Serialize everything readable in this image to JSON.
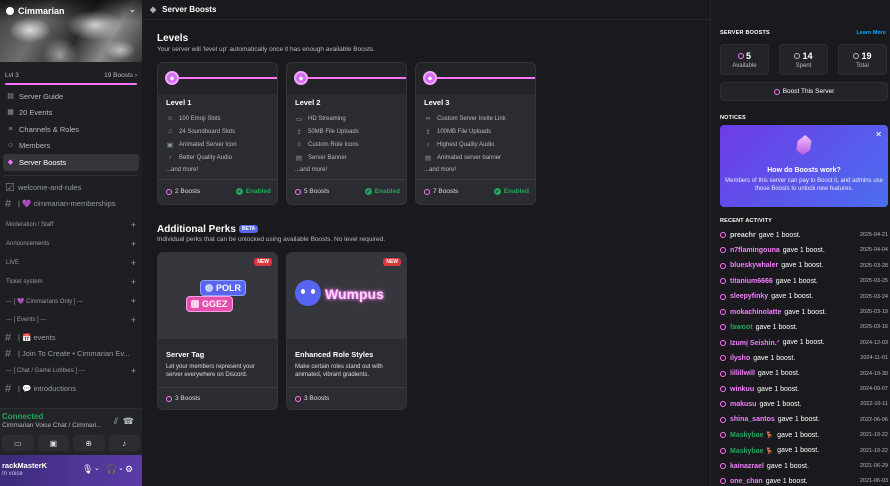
{
  "sidebar": {
    "server_name": "Cimmarian",
    "level_label": "Lvl 3",
    "boosts_label": "19 Boosts",
    "boost_progress": 1.0,
    "nav": [
      {
        "label": "Server Guide",
        "icon": "guide-icon"
      },
      {
        "label": "20 Events",
        "icon": "calendar-icon"
      },
      {
        "label": "Channels & Roles",
        "icon": "channels-icon"
      },
      {
        "label": "Members",
        "icon": "members-icon"
      },
      {
        "label": "Server Boosts",
        "icon": "boost-icon",
        "active": true
      }
    ],
    "channels_top": [
      {
        "label": "welcome-and-rules",
        "icon": "rules-icon"
      },
      {
        "label": "| 💜 cimmarian-memberships",
        "icon": "hash-icon"
      }
    ],
    "categories": [
      "Moderation / Staff",
      "Announcements",
      "LIVE",
      "Ticket system",
      "--- [ 💜 Cimmarians Only ] ---",
      "--- [ Events ] ---",
      "--- [ Chat / Game Lobbies ] ---"
    ],
    "channels_events": [
      {
        "label": "| 📅 events"
      },
      {
        "label": "| Join To Create • Cimmarian Ev..."
      }
    ],
    "channels_chat": [
      {
        "label": "| 💬 introductions"
      }
    ],
    "voice": {
      "status": "Connected",
      "channel": "Cimmarian Voice Chat / Cimmari..."
    },
    "user": {
      "name": "rackMasterK",
      "status": "In voice"
    }
  },
  "header": {
    "title": "Server Boosts"
  },
  "levels": {
    "title": "Levels",
    "subtitle": "Your server will 'level up' automatically once it has enough available Boosts.",
    "cards": [
      {
        "name": "Level 1",
        "perks": [
          "100 Emoji Slots",
          "24 Soundboard Slots",
          "Animated Server Icon",
          "Better Quality Audio",
          "...and more!"
        ],
        "boosts": "2 Boosts",
        "status": "Enabled"
      },
      {
        "name": "Level 2",
        "perks": [
          "HD Streaming",
          "50MB File Uploads",
          "Custom Role Icons",
          "Server Banner",
          "...and more!"
        ],
        "boosts": "5 Boosts",
        "status": "Enabled"
      },
      {
        "name": "Level 3",
        "perks": [
          "Custom Server Invite Link",
          "100MB File Uploads",
          "Highest Quality Audio",
          "Animated server banner",
          "...and more!"
        ],
        "boosts": "7 Boosts",
        "status": "Enabled"
      }
    ]
  },
  "perks": {
    "title": "Additional Perks",
    "badge": "BETA",
    "subtitle": "Individual perks that can be unlocked using available Boosts. No level required.",
    "cards": [
      {
        "new": "NEW",
        "title": "Server Tag",
        "desc": "Let your members represent your server everywhere on Discord.",
        "boosts": "3 Boosts",
        "chips": [
          "POLR",
          "GGEZ"
        ]
      },
      {
        "new": "NEW",
        "title": "Enhanced Role Styles",
        "desc": "Make certain roles stand out with animated, vibrant gradients.",
        "boosts": "3 Boosts",
        "art_text": "Wumpus"
      }
    ]
  },
  "right": {
    "heading": "SERVER BOOSTS",
    "learn_more": "Learn More",
    "stats": [
      {
        "value": "5",
        "label": "Available"
      },
      {
        "value": "14",
        "label": "Spent"
      },
      {
        "value": "19",
        "label": "Total"
      }
    ],
    "boost_button": "Boost This Server",
    "notices_heading": "NOTICES",
    "notice": {
      "title": "How do Boosts work?",
      "desc": "Members of this server can pay to Boost it, and admins use those Boosts to unlock new features."
    },
    "activity_heading": "RECENT ACTIVITY",
    "activity": [
      {
        "user": "preachr",
        "action": "gave 1 boost.",
        "date": "2025-04-21",
        "color": "#dbdee1"
      },
      {
        "user": "n7flamingouna",
        "action": "gave 1 boost.",
        "date": "2025-04-04",
        "color": "#f47fff"
      },
      {
        "user": "blueskywhaler",
        "action": "gave 1 boost.",
        "date": "2025-03-28",
        "color": "#f47fff"
      },
      {
        "user": "titanium6666",
        "action": "gave 1 boost.",
        "date": "2025-03-25",
        "color": "#f47fff"
      },
      {
        "user": "sleepyfinky",
        "action": "gave 1 boost.",
        "date": "2025-03-24",
        "color": "#f47fff"
      },
      {
        "user": "mokachinolatte",
        "action": "gave 1 boost.",
        "date": "2025-03-19",
        "color": "#f47fff"
      },
      {
        "user": "fawoot",
        "action": "gave 1 boost.",
        "date": "2025-03-16",
        "color": "#23a55a"
      },
      {
        "user": "Izumį Seishin.ᐟ",
        "action": "gave 1 boost.",
        "date": "2024-12-03",
        "color": "#f47fff"
      },
      {
        "user": "ilysho",
        "action": "gave 1 boost.",
        "date": "2024-11-01",
        "color": "#f47fff"
      },
      {
        "user": "lillillwill",
        "action": "gave 1 boost.",
        "date": "2024-10-30",
        "color": "#f47fff"
      },
      {
        "user": "winkuu",
        "action": "gave 1 boost.",
        "date": "2024-09-07",
        "color": "#f47fff"
      },
      {
        "user": "makusu",
        "action": "gave 1 boost.",
        "date": "2022-10-11",
        "color": "#f47fff"
      },
      {
        "user": "shina_santos",
        "action": "gave 1 boost.",
        "date": "2022-06-06",
        "color": "#f47fff"
      },
      {
        "user": "Maskybae 🦌",
        "action": "gave 1 boost.",
        "date": "2021-10-22",
        "color": "#23a55a"
      },
      {
        "user": "Maskybae 🦌",
        "action": "gave 1 boost.",
        "date": "2021-10-22",
        "color": "#23a55a"
      },
      {
        "user": "kainazrael",
        "action": "gave 1 boost.",
        "date": "2021-06-29",
        "color": "#f47fff"
      },
      {
        "user": "one_chan",
        "action": "gave 1 boost.",
        "date": "2021-06-03",
        "color": "#f47fff"
      }
    ]
  }
}
